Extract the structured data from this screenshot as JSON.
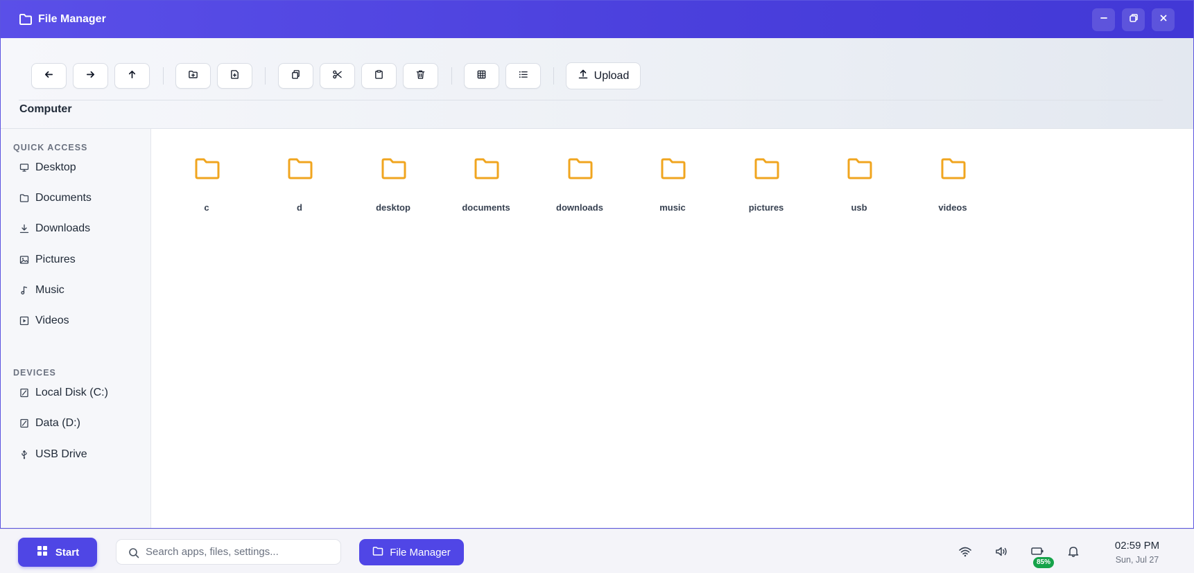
{
  "window": {
    "title": "File Manager",
    "title_icon": "folder-icon",
    "controls": [
      "minimize-icon",
      "restore-icon",
      "close-icon"
    ]
  },
  "toolbar": {
    "groups": [
      [
        "back-arrow-icon",
        "forward-arrow-icon",
        "up-arrow-icon"
      ],
      [
        "new-folder-icon",
        "new-file-icon"
      ],
      [
        "copy-icon",
        "cut-icon",
        "paste-icon",
        "delete-icon"
      ],
      [
        "grid-view-icon",
        "list-view-icon"
      ]
    ],
    "upload_label": "Upload",
    "upload_icon": "upload-icon"
  },
  "path": {
    "current": "Computer"
  },
  "sidebar": {
    "quick_access_heading": "QUICK ACCESS",
    "quick_access": [
      {
        "label": "Desktop",
        "icon": "monitor-icon"
      },
      {
        "label": "Documents",
        "icon": "folder-icon"
      },
      {
        "label": "Downloads",
        "icon": "download-icon"
      },
      {
        "label": "Pictures",
        "icon": "image-icon"
      },
      {
        "label": "Music",
        "icon": "music-note-icon"
      },
      {
        "label": "Videos",
        "icon": "video-icon"
      }
    ],
    "devices_heading": "DEVICES",
    "devices": [
      {
        "label": "Local Disk (C:)",
        "icon": "drive-icon"
      },
      {
        "label": "Data (D:)",
        "icon": "drive-icon"
      },
      {
        "label": "USB Drive",
        "icon": "usb-icon"
      }
    ]
  },
  "folders": [
    "c",
    "d",
    "desktop",
    "documents",
    "downloads",
    "music",
    "pictures",
    "usb",
    "videos"
  ],
  "taskbar": {
    "start_label": "Start",
    "start_icon": "windows-grid-icon",
    "search_placeholder": "Search apps, files, settings...",
    "active_app_label": "File Manager",
    "active_app_icon": "folder-icon",
    "tray_icons": [
      "wifi-icon",
      "volume-icon",
      "battery-icon",
      "bell-icon"
    ],
    "battery_percent": "85%",
    "time": "02:59 PM",
    "date": "Sun, Jul 27"
  },
  "colors": {
    "accent": "#4f46e5",
    "folder": "#f0a51f",
    "battery_badge": "#16a34a"
  }
}
